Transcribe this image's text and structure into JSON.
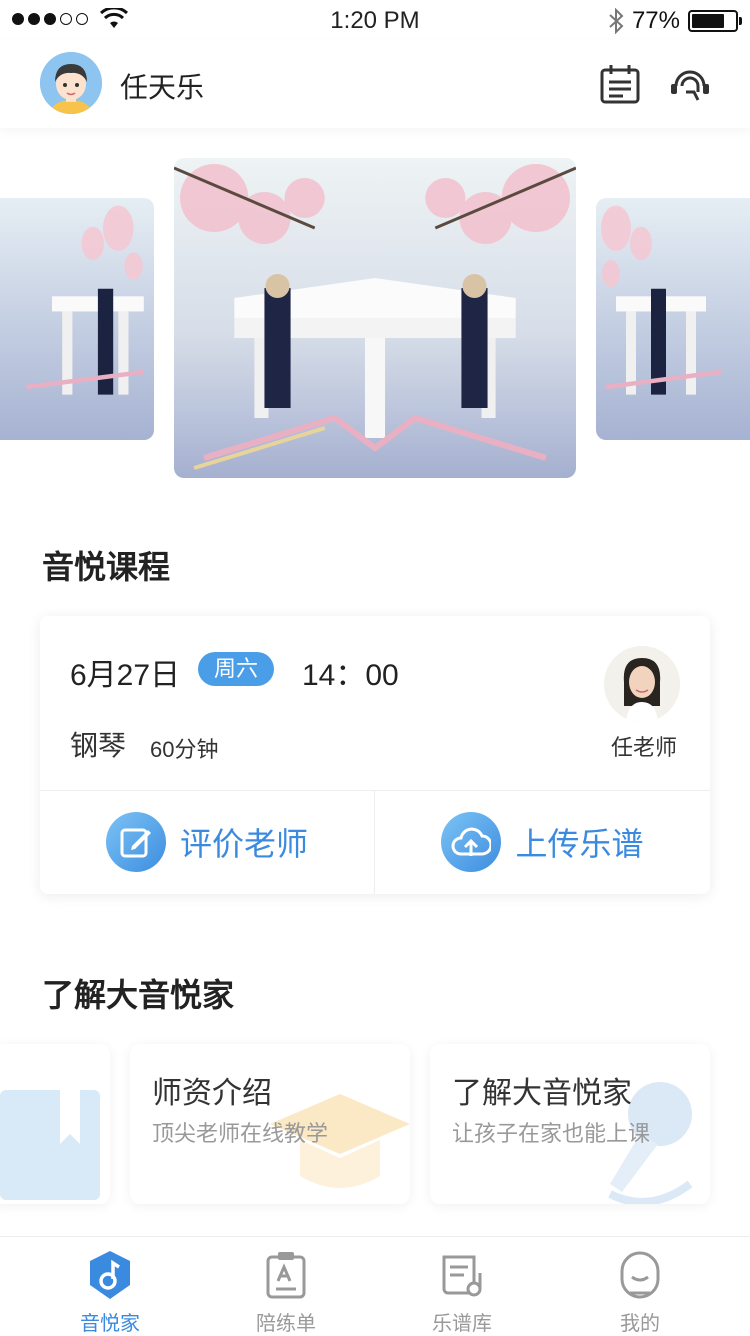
{
  "status_bar": {
    "time": "1:20 PM",
    "battery": "77%",
    "battery_level": 0.77
  },
  "header": {
    "username": "任天乐"
  },
  "sections": {
    "course_title": "音悦课程",
    "about_title": "了解大音悦家"
  },
  "course": {
    "date": "6月27日",
    "weekday": "周六",
    "time": "14：00",
    "instrument": "钢琴",
    "duration": "60分钟",
    "teacher": "任老师",
    "actions": {
      "rate": "评价老师",
      "upload": "上传乐谱"
    }
  },
  "about_cards": [
    {
      "title": "师资介绍",
      "subtitle": "顶尖老师在线教学"
    },
    {
      "title": "了解大音悦家",
      "subtitle": "让孩子在家也能上课"
    }
  ],
  "tabs": [
    {
      "label": "音悦家",
      "active": true
    },
    {
      "label": "陪练单",
      "active": false
    },
    {
      "label": "乐谱库",
      "active": false
    },
    {
      "label": "我的",
      "active": false
    }
  ],
  "colors": {
    "accent": "#3a8be0",
    "badge": "#4a9ee8"
  }
}
